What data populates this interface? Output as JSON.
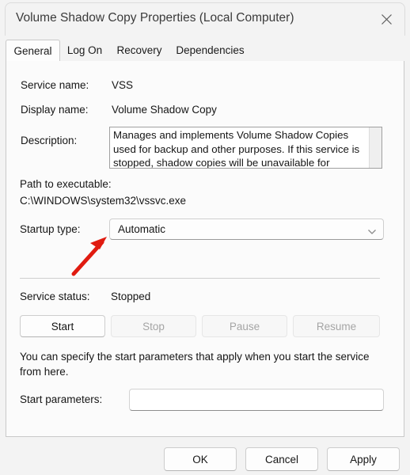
{
  "window": {
    "title": "Volume Shadow Copy Properties (Local Computer)",
    "close_icon": "close-icon"
  },
  "tabs": [
    {
      "label": "General",
      "selected": true
    },
    {
      "label": "Log On",
      "selected": false
    },
    {
      "label": "Recovery",
      "selected": false
    },
    {
      "label": "Dependencies",
      "selected": false
    }
  ],
  "general": {
    "service_name_label": "Service name:",
    "service_name_value": "VSS",
    "display_name_label": "Display name:",
    "display_name_value": "Volume Shadow Copy",
    "description_label": "Description:",
    "description_value": "Manages and implements Volume Shadow Copies used for backup and other purposes. If this service is stopped, shadow copies will be unavailable for",
    "path_label": "Path to executable:",
    "path_value": "C:\\WINDOWS\\system32\\vssvc.exe",
    "startup_type_label": "Startup type:",
    "startup_type_value": "Automatic",
    "startup_type_chevron": "chevron-down-icon",
    "service_status_label": "Service status:",
    "service_status_value": "Stopped",
    "controls": [
      {
        "label": "Start",
        "enabled": true
      },
      {
        "label": "Stop",
        "enabled": false
      },
      {
        "label": "Pause",
        "enabled": false
      },
      {
        "label": "Resume",
        "enabled": false
      }
    ],
    "help_text": "You can specify the start parameters that apply when you start the service from here.",
    "start_parameters_label": "Start parameters:",
    "start_parameters_value": "",
    "start_parameters_placeholder": ""
  },
  "footer": {
    "ok_label": "OK",
    "cancel_label": "Cancel",
    "apply_label": "Apply"
  },
  "annotation": {
    "arrow_color": "#e01b10",
    "arrow_name": "red-arrow-annotation"
  }
}
